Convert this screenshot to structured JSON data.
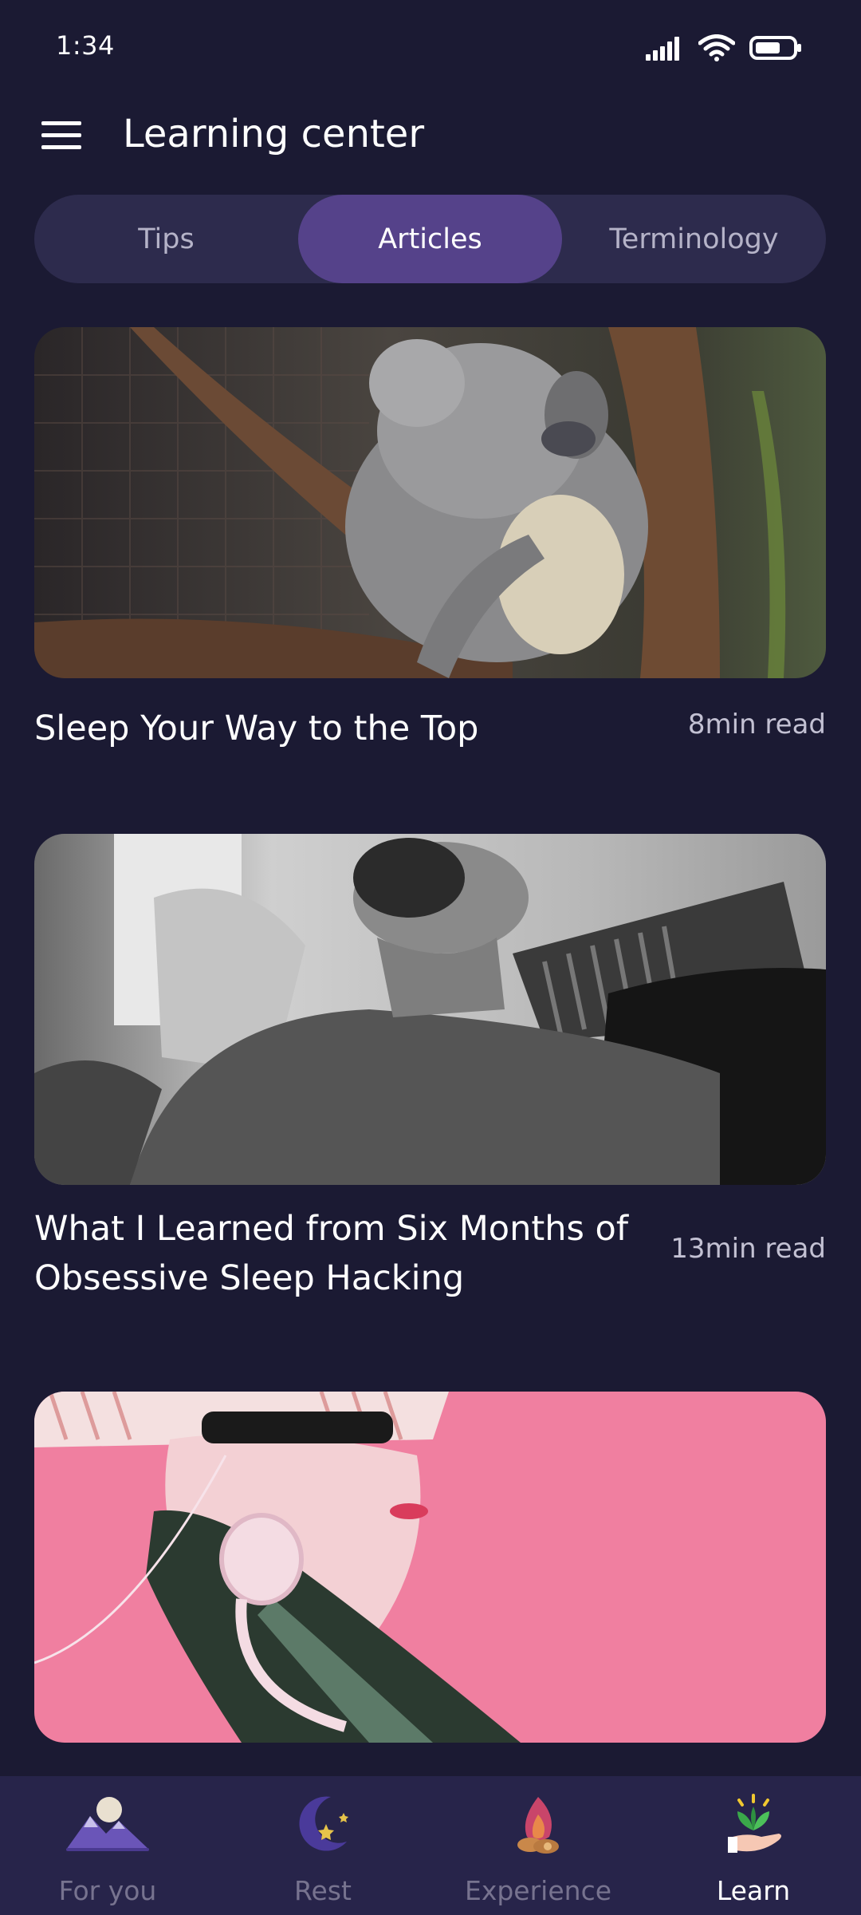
{
  "status_bar": {
    "time": "1:34"
  },
  "header": {
    "title": "Learning center",
    "menu_icon": "hamburger-menu-icon"
  },
  "tabs": [
    {
      "label": "Tips",
      "active": false
    },
    {
      "label": "Articles",
      "active": true
    },
    {
      "label": "Terminology",
      "active": false
    }
  ],
  "articles": [
    {
      "title": "Sleep Your Way to the Top",
      "read_time": "8min read",
      "image": "sleeping-koala-photo"
    },
    {
      "title": "What I Learned from Six Months of Obsessive Sleep Hacking",
      "read_time": "13min read",
      "image": "man-sleeping-on-couch-photo"
    },
    {
      "title": "",
      "read_time": "",
      "image": "woman-with-headphones-photo"
    }
  ],
  "bottom_nav": [
    {
      "label": "For you",
      "icon": "mountains-moon-icon",
      "active": false
    },
    {
      "label": "Rest",
      "icon": "crescent-moon-stars-icon",
      "active": false
    },
    {
      "label": "Experience",
      "icon": "campfire-icon",
      "active": false
    },
    {
      "label": "Learn",
      "icon": "hand-sprout-icon",
      "active": true
    }
  ],
  "colors": {
    "background": "#1b1a33",
    "tab_track": "#2d2b4d",
    "tab_active": "#55428a",
    "nav_background": "#27244a"
  }
}
